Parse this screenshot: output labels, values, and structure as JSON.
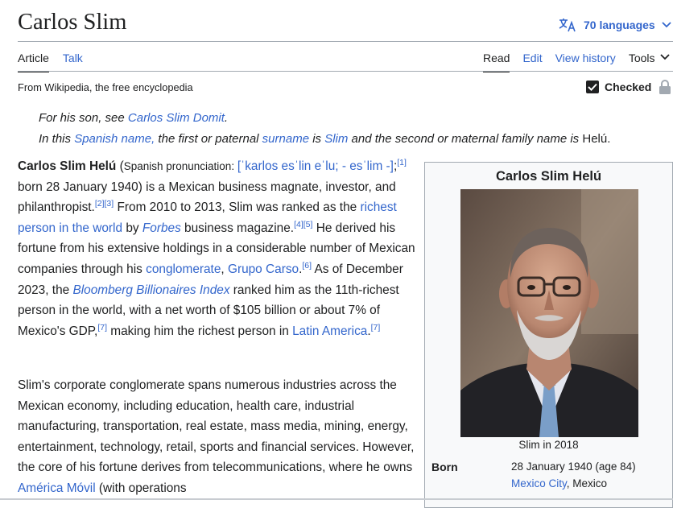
{
  "header": {
    "title": "Carlos Slim",
    "languages_label": "70 languages"
  },
  "tabs": {
    "left": [
      "Article",
      "Talk"
    ],
    "right": [
      "Read",
      "Edit",
      "View history",
      "Tools"
    ]
  },
  "tagline": "From Wikipedia, the free encyclopedia",
  "checked_label": "Checked",
  "hatnotes": {
    "line1": {
      "text": "For his son, see ",
      "link": "Carlos Slim Domit",
      "end": "."
    },
    "line2": {
      "t1": "In this ",
      "l1": "Spanish name,",
      "t2": " the first or paternal ",
      "l2": "surname",
      "t3": " is ",
      "l3": "Slim",
      "t4": " and the second or maternal family name is ",
      "t5": "Helú."
    }
  },
  "paragraph1": {
    "name_bold": "Carlos Slim Helú",
    "pron_open": " (",
    "pron_label": "Spanish pronunciation: ",
    "ipa": "[ˈkarlos esˈlin eˈlu; - esˈlim -]",
    "semi": ";",
    "ref1": "[1]",
    "t1": " born 28 January 1940) is a Mexican business magnate, investor, and philanthropist.",
    "ref2": "[2]",
    "ref3": "[3]",
    "t2": " From 2010 to 2013, Slim was ranked as the ",
    "l_richest": "richest person in the world",
    "t3": " by ",
    "l_forbes": "Forbes",
    "t4": " business magazine.",
    "ref4": "[4]",
    "ref5": "[5]",
    "t5": " He derived his fortune from his extensive holdings in a considerable number of Mexican companies through his ",
    "l_conglomerate": "conglomerate",
    "t6": ", ",
    "l_grupo": "Grupo Carso",
    "t7": ".",
    "ref6": "[6]",
    "t8": " As of December 2023, the ",
    "l_bloomberg": "Bloomberg Billionaires Index",
    "t9": " ranked him as the 11th-richest person in the world, with a net worth of $105 billion or about 7% of Mexico's GDP,",
    "ref7a": "[7]",
    "t10": " making him the richest person in ",
    "l_latam": "Latin America",
    "t11": ".",
    "ref7b": "[7]"
  },
  "paragraph2": {
    "t1": "Slim's corporate conglomerate spans numerous industries across the Mexican economy, including education, health care, industrial manufacturing, transportation, real estate, mass media, mining, energy, entertainment, technology, retail, sports and financial services. However, the core of his fortune derives from telecommunications, where he owns ",
    "l_america": "América Móvil",
    "t2": " (with operations"
  },
  "infobox": {
    "title": "Carlos Slim Helú",
    "caption": "Slim in 2018",
    "born_label": "Born",
    "born_date": "28 January 1940 (age 84)",
    "born_city": "Mexico City",
    "born_sep": ", ",
    "born_country": "Mexico"
  }
}
